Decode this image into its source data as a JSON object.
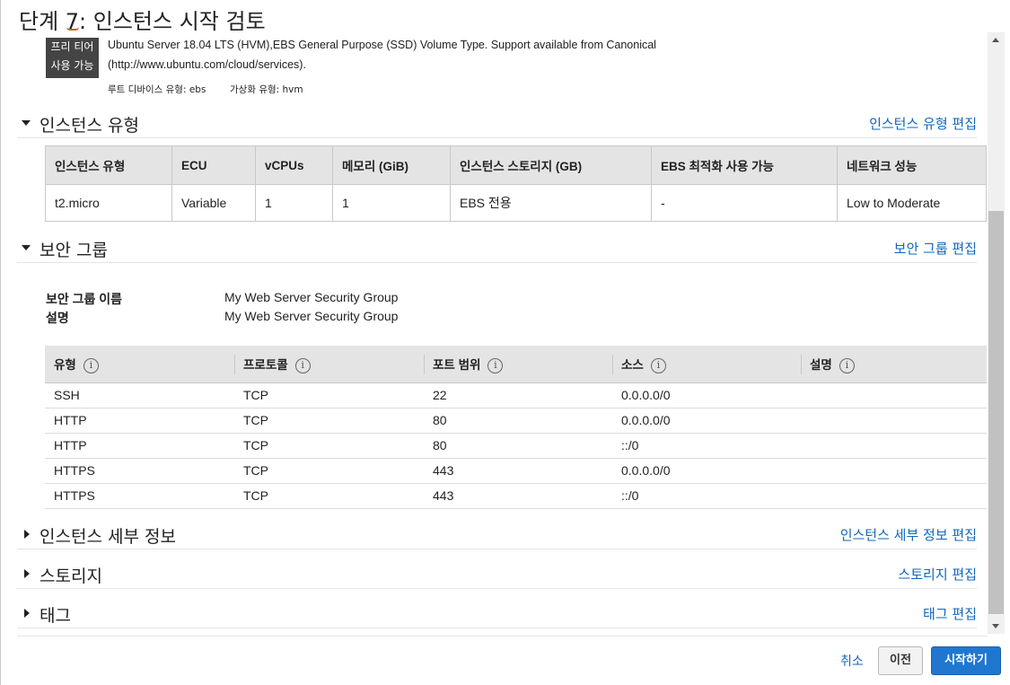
{
  "page": {
    "title": "단계 7: 인스턴스 시작 검토"
  },
  "ami": {
    "badge_line1": "프리 티어",
    "badge_line2": "사용 가능",
    "description_line1": "Ubuntu Server 18.04 LTS (HVM),EBS General Purpose (SSD) Volume Type. Support available from Canonical",
    "description_line2": "(http://www.ubuntu.com/cloud/services).",
    "root_device_label": "루트 디바이스 유형: ebs",
    "virtualization_label": "가상화 유형: hvm"
  },
  "instance_type": {
    "title": "인스턴스 유형",
    "edit_link": "인스턴스 유형 편집",
    "headers": [
      "인스턴스 유형",
      "ECU",
      "vCPUs",
      "메모리 (GiB)",
      "인스턴스 스토리지 (GB)",
      "EBS 최적화 사용 가능",
      "네트워크 성능"
    ],
    "row": [
      "t2.micro",
      "Variable",
      "1",
      "1",
      "EBS 전용",
      "-",
      "Low to Moderate"
    ]
  },
  "security_group": {
    "title": "보안 그룹",
    "edit_link": "보안 그룹 편집",
    "name_label": "보안 그룹 이름",
    "name_value": "My Web Server Security Group",
    "desc_label": "설명",
    "desc_value": "My Web Server Security Group",
    "headers": [
      "유형",
      "프로토콜",
      "포트 범위",
      "소스",
      "설명"
    ],
    "info_icon": "i",
    "rules": [
      [
        "SSH",
        "TCP",
        "22",
        "0.0.0.0/0",
        ""
      ],
      [
        "HTTP",
        "TCP",
        "80",
        "0.0.0.0/0",
        ""
      ],
      [
        "HTTP",
        "TCP",
        "80",
        "::/0",
        ""
      ],
      [
        "HTTPS",
        "TCP",
        "443",
        "0.0.0.0/0",
        ""
      ],
      [
        "HTTPS",
        "TCP",
        "443",
        "::/0",
        ""
      ]
    ]
  },
  "instance_details": {
    "title": "인스턴스 세부 정보",
    "edit_link": "인스턴스 세부 정보 편집"
  },
  "storage": {
    "title": "스토리지",
    "edit_link": "스토리지 편집"
  },
  "tags": {
    "title": "태그",
    "edit_link": "태그 편집"
  },
  "footer": {
    "cancel": "취소",
    "previous": "이전",
    "launch": "시작하기"
  },
  "colors": {
    "link": "#1166bb",
    "primary_button": "#1f77d0",
    "header_bg": "#e4e4e4"
  }
}
